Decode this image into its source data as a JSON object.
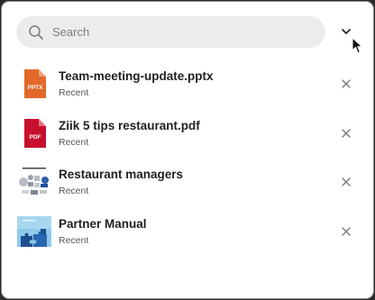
{
  "search": {
    "placeholder": "Search"
  },
  "recent_items": [
    {
      "title": "Team-meeting-update.pptx",
      "subtitle": "Recent",
      "file_type": "pptx",
      "badge": "PPTX",
      "color": "#e2692a"
    },
    {
      "title": "Ziik 5 tips restaurant.pdf",
      "subtitle": "Recent",
      "file_type": "pdf",
      "badge": "PDF",
      "color": "#c8102e"
    },
    {
      "title": "Restaurant managers",
      "subtitle": "Recent",
      "file_type": "image",
      "icon": "image-thumbnail"
    },
    {
      "title": "Partner Manual",
      "subtitle": "Recent",
      "file_type": "image",
      "icon": "puzzle-thumbnail"
    }
  ],
  "icons": {
    "search": "search-icon",
    "expand": "chevron-down-icon",
    "remove": "close-icon"
  }
}
